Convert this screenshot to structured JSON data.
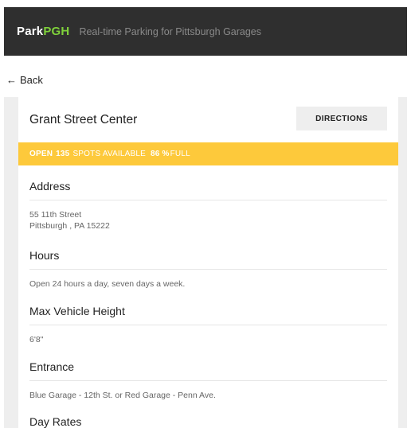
{
  "header": {
    "brand_part1": "Park",
    "brand_part2": "PGH",
    "tagline": "Real-time Parking for Pittsburgh Garages"
  },
  "nav": {
    "back_arrow": "←",
    "back_label": "Back"
  },
  "garage": {
    "name": "Grant Street Center",
    "directions_label": "DIRECTIONS",
    "status": {
      "open": "OPEN",
      "spots": "135",
      "spots_text": "SPOTS AVAILABLE",
      "percent": "86 %",
      "full_text": "FULL"
    }
  },
  "sections": {
    "address": {
      "title": "Address",
      "line1": "55 11th Street",
      "line2": "Pittsburgh , PA 15222"
    },
    "hours": {
      "title": "Hours",
      "text": "Open 24 hours a day, seven days a week."
    },
    "max_height": {
      "title": "Max Vehicle Height",
      "text": "6'8\""
    },
    "entrance": {
      "title": "Entrance",
      "text": "Blue Garage - 12th St. or Red Garage - Penn Ave."
    },
    "day_rates": {
      "title": "Day Rates"
    }
  },
  "colors": {
    "header_bg": "#2f2f2f",
    "brand_accent": "#7fd13b",
    "status_bar": "#fdc93b"
  }
}
